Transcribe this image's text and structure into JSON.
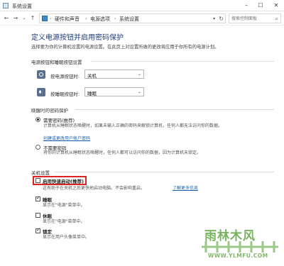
{
  "window": {
    "title": "系统设置"
  },
  "address": {
    "crumbs": [
      "硬件和声音",
      "电源选项",
      "系统设置"
    ],
    "search_placeholder": "搜索控制面板"
  },
  "page": {
    "heading": "定义电源按钮并启用密码保护",
    "subheading": "选择要为你的计算机设置的电源设置。在此页上对设置所做的更改将应用于你所有的电源计划。"
  },
  "power_buttons": {
    "group_title": "电源按钮和睡眠按钮设置",
    "rows": [
      {
        "label": "按电源按钮时:",
        "value": "关机"
      },
      {
        "label": "按睡眠按钮时:",
        "value": "睡眠"
      }
    ]
  },
  "wake_password": {
    "group_title": "唤醒时的密码保护",
    "options": [
      {
        "label": "需要密码(推荐)",
        "desc": "计算机从睡眠状态唤醒时，如果未输入正确的密码来解锁计算机，任何人都无法访问你的数据。",
        "link": "创建或更改用户帐户密码",
        "selected": true
      },
      {
        "label": "不需要密码",
        "desc": "将你的计算机从睡眠状态唤醒时，任何人都可以访问你的数据，因为计算机未锁定。",
        "selected": false
      }
    ]
  },
  "shutdown": {
    "group_title": "关机设置",
    "items": [
      {
        "label": "启用快速启动(推荐)",
        "desc": "这有助于在关机之后更快地启动电脑。不会影响重启。",
        "link": "了解更多信息",
        "checked": false
      },
      {
        "label": "睡眠",
        "desc": "显示在\"电源\"菜单中。",
        "checked": true
      },
      {
        "label": "休眠",
        "desc": "显示在\"电源\"菜单中。",
        "checked": false
      },
      {
        "label": "锁定",
        "desc": "显示在用户头像菜单中。",
        "checked": true
      }
    ]
  },
  "watermark": {
    "brand": "雨林木风",
    "url": "WWW.YLMFU.COM"
  },
  "colors": {
    "heading": "#1e3c78",
    "link": "#1c5fae",
    "highlight": "#dd2222",
    "watermark": "#4c9a2a"
  }
}
